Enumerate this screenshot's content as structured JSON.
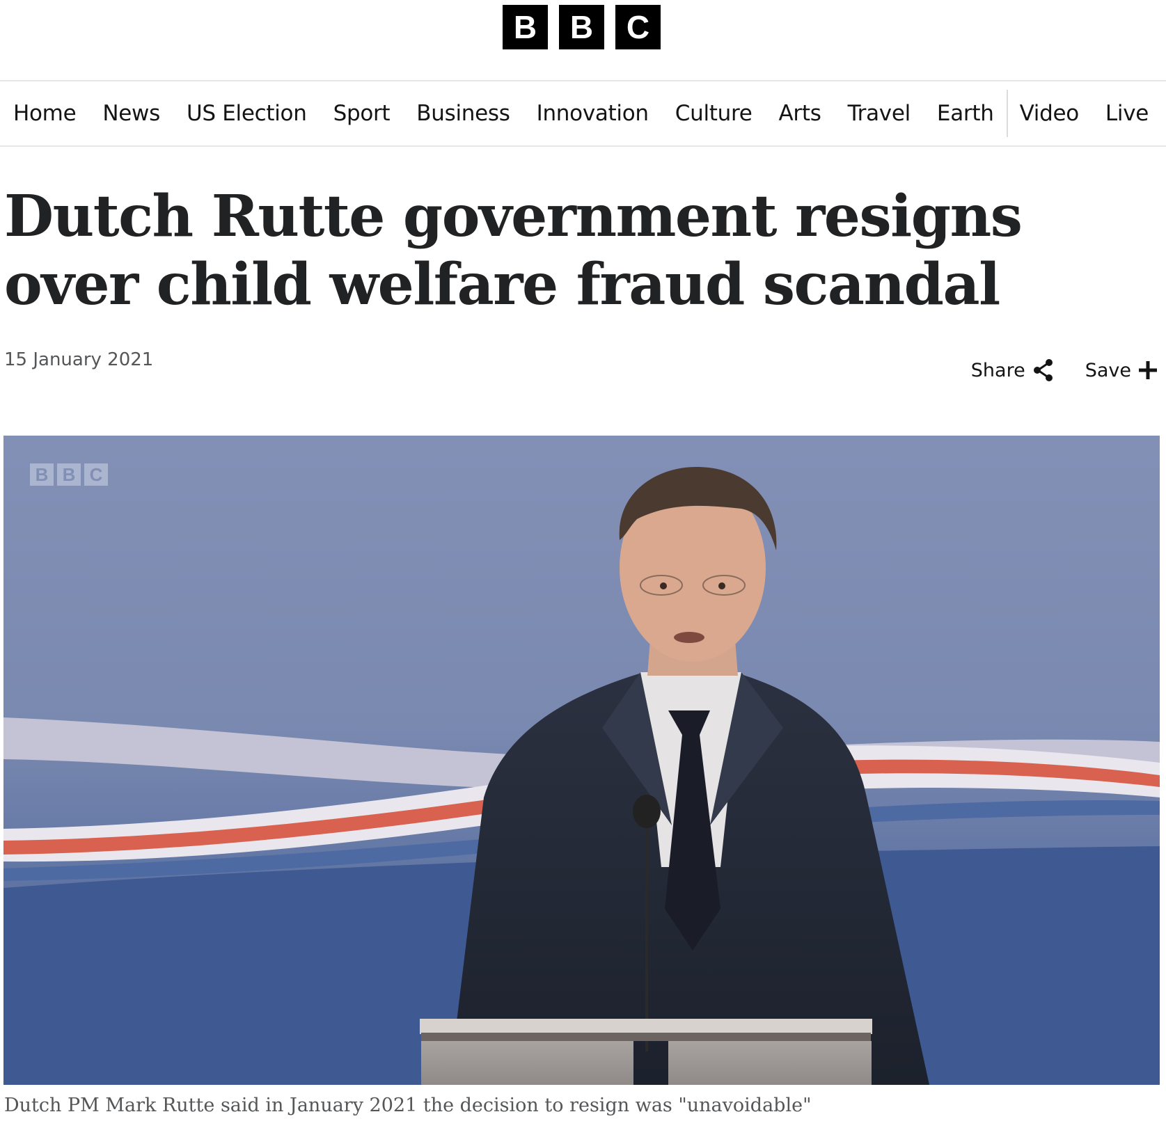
{
  "brand": {
    "letters": [
      "B",
      "B",
      "C"
    ],
    "watermark_letters": [
      "B",
      "B",
      "C"
    ]
  },
  "nav": {
    "items": [
      "Home",
      "News",
      "US Election",
      "Sport",
      "Business",
      "Innovation",
      "Culture",
      "Arts",
      "Travel",
      "Earth"
    ],
    "secondary_items": [
      "Video",
      "Live"
    ]
  },
  "article": {
    "headline": "Dutch Rutte government resigns over child welfare fraud scandal",
    "date": "15 January 2021",
    "share_label": "Share",
    "save_label": "Save",
    "image_caption": "Dutch PM Mark Rutte said in January 2021 the decision to resign was \"unavoidable\""
  },
  "icons": {
    "share": "share-icon",
    "save": "plus-icon"
  },
  "colors": {
    "logo_block": "#000000",
    "headline": "#202224",
    "meta_text": "#545658",
    "divider": "#e6e6e6"
  }
}
